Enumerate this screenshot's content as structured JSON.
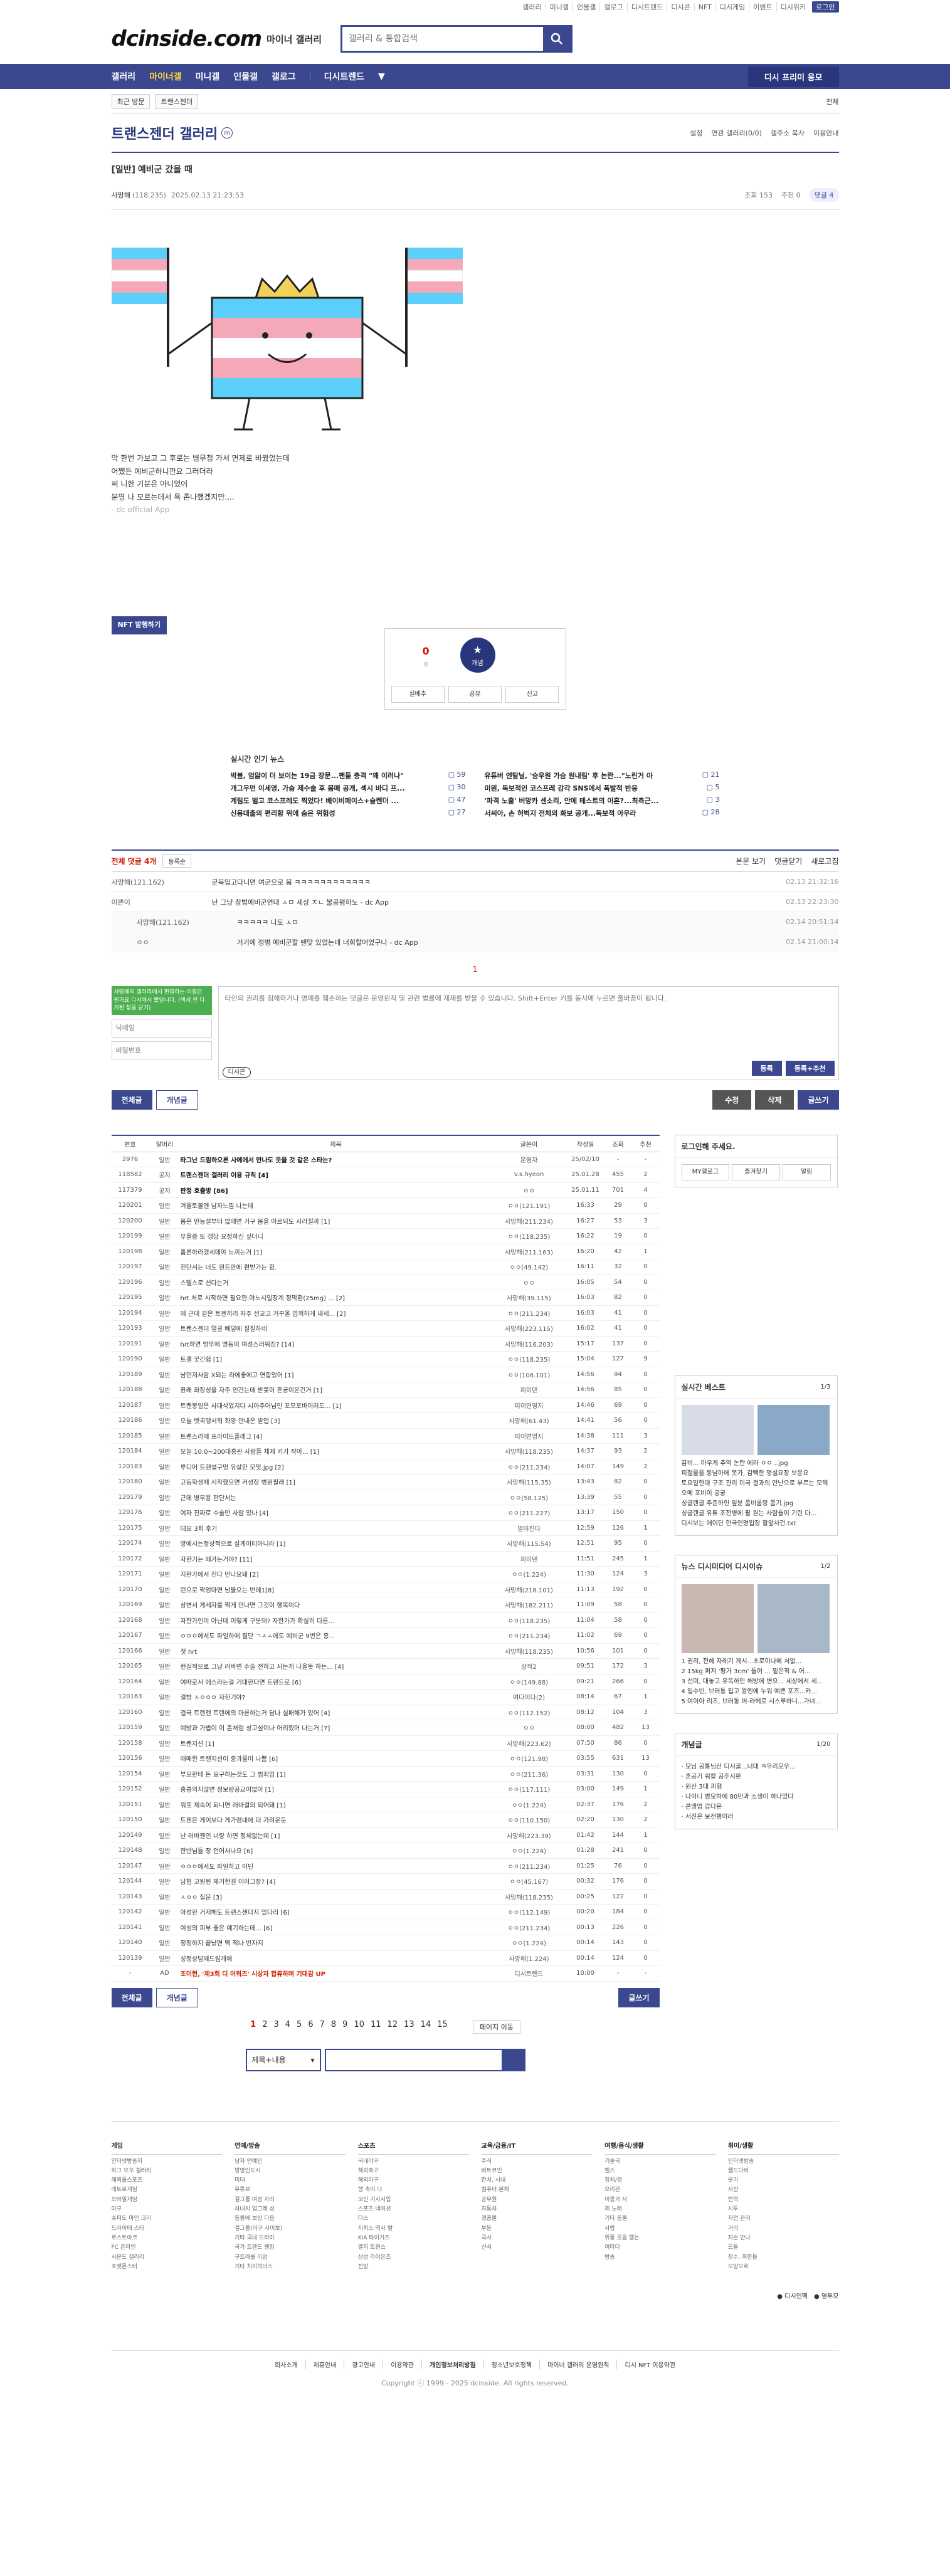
{
  "topnav": [
    "갤러리",
    "미니갤",
    "인물갤",
    "갤로그",
    "디시트렌드",
    "디시콘",
    "NFT",
    "디시게임",
    "이벤트",
    "디시위키"
  ],
  "login_label": "로그인",
  "site": {
    "logo": "dcinside.com",
    "logo_sub": "마이너 갤러리",
    "search_placeholder": "갤러리 & 통합검색"
  },
  "gnb": {
    "items": [
      "갤러리",
      "마이너갤",
      "미니갤",
      "인물갤",
      "갤로그",
      "디시트렌드"
    ],
    "report_btn": "디시 프리미 응모"
  },
  "subbar": {
    "recent": "최근 방문",
    "crumb": "트랜스젠더",
    "all": "전체"
  },
  "gallery": {
    "title": "트랜스젠더 갤러리",
    "menu": [
      "설정",
      "연관 갤러리(0/0)",
      "갤주소 복사",
      "이용안내"
    ]
  },
  "post": {
    "category": "[일반]",
    "title": "예비군 갔을 때",
    "author": "사망해",
    "author_ip": "(118.235)",
    "date": "2025.02.13 21:23:53",
    "views": "조회 153",
    "recommend": "추천 0",
    "comments_badge": "댓글 4",
    "body": [
      "막 한번 가보고 그 후로는 병무청 가서 면제로 바꿨었는데",
      "어쨌든 예비군하니깐요 그러더라",
      "써 니한 기분은 아니었어",
      "분명 나 모르는데서 욕 존나했겠지만....",
      "- dc official App"
    ],
    "nft_label": "NFT 발행하기",
    "recommend_count": "0",
    "recommend_sub": "0",
    "gaenyeom": "개념",
    "share_actions": [
      "실베추",
      "공유",
      "신고"
    ]
  },
  "news": {
    "title": "실시간 인기 뉴스",
    "items": [
      {
        "t": "박봄, 엄앓이 더 보이는 19금 장문...팬들 충격 \"왜 이러나\"",
        "c": "59"
      },
      {
        "t": "유튜버 엔탈닐, '승우원 가슴 원내림' 후 논란...\"노린거 아",
        "c": "21"
      },
      {
        "t": "개그우먼 이세영, 가슴 제수술 후 몸매 공개, 섹시 바디 프...",
        "c": "30"
      },
      {
        "t": "미원, 독보적인 코스프레 감각 SNS에서 폭발적 반응",
        "c": "5"
      },
      {
        "t": "계림도 벌고 코스프레도 찍었다! 베이비페이스+슬렌더 ...",
        "c": "47"
      },
      {
        "t": "'파격 노출' 버망카 센소리, 안에 테스트의 이혼?...최측근...",
        "c": "3"
      },
      {
        "t": "신용대출의 편리함 위에 숨은 위험성",
        "c": "27"
      },
      {
        "t": "서씨아, 손 허벅지 전체의 화보 공개...독보적 아우라",
        "c": "28"
      }
    ]
  },
  "comments": {
    "header": "전체 댓글 4개",
    "sort": "등록순",
    "right": [
      "본문 보기",
      "댓글닫기",
      "새로고침"
    ],
    "list": [
      {
        "nick": "사망해(121.162)",
        "text": "군복입고다니면 여군으로 봄 ㅋㅋㅋㅋㅋㅋㅋㅋㅋㅋㅋㅋ",
        "date": "02.13 21:32:16",
        "reply": false
      },
      {
        "nick": "이쁜이",
        "text": "난 그냥 창법에비군연대 ㅅㅁ 세상 ㅈㄴ 불공평하노 - dc App",
        "date": "02.13 22:23:30",
        "reply": false
      },
      {
        "nick": "사망해(121.162)",
        "text": "ㅋㅋㅋㅋㅋ 나도 ㅅㅁ",
        "date": "02.14 20:51:14",
        "reply": true
      },
      {
        "nick": "ㅇㅇ",
        "text": "거기에 정병 예비군할 땐맞 있었는데 너희할어었구나 - dc App",
        "date": "02.14 21:00:14",
        "reply": true
      }
    ],
    "page_no": "1",
    "write": {
      "nick_placeholder": "닉네임",
      "pw_placeholder": "비밀번호",
      "placeholder": "타인의 권리를 침해하거나 명예를 훼손하는 댓글은 운영원칙 및 관련 법률에 제재를 받을 수 있습니다. Shift+Enter 키를 동시에 누르면 줄바꿈이 됩니다.",
      "dccon": "디시콘",
      "submit": "등록",
      "submit2": "등록+추천",
      "tip": "사망해의 갤러리에서 편집하는 이점은 뭔가요 디시에서 봤답니다. (액세 전 다게된 창을 닫기)"
    }
  },
  "actions": {
    "all": "전체글",
    "best": "개념글",
    "edit": "수정",
    "delete": "삭제",
    "write": "글쓰기"
  },
  "board": {
    "headers": [
      "번호",
      "말머리",
      "제목",
      "글쓴이",
      "작성일",
      "조회",
      "추천"
    ],
    "rows": [
      [
        "2976",
        "일반",
        "타그난 드림하오른 사에에서 만나도 웃을 것 같은 스타는?",
        "운영자",
        "25/02/10",
        "-",
        "-",
        "n"
      ],
      [
        "118582",
        "공지",
        "트랜스젠더 갤러리 이용 규칙 [4]",
        "v.s.hyeon",
        "25.01.28",
        "455",
        "2",
        "n"
      ],
      [
        "117379",
        "공지",
        "판정 호출방 [86]",
        "ㅇㅇ",
        "25.01.11",
        "701",
        "4",
        "n"
      ],
      [
        "120201",
        "일반",
        "겨울토불엔 남자느낌 나는데",
        "ㅇㅇ(121.191)",
        "16:33",
        "29",
        "0",
        ""
      ],
      [
        "120200",
        "일반",
        "몸은 만능설부터 없애면 거구 몸을 아르되도 사라질까 [1]",
        "사망해(211.234)",
        "16:27",
        "53",
        "3",
        ""
      ],
      [
        "120199",
        "일반",
        "우울증 또 갱당 요정하신 싶더니",
        "ㅇㅇ(118.235)",
        "16:22",
        "19",
        "0",
        ""
      ],
      [
        "120198",
        "일반",
        "홈론하라겠세데야 느끼는거 [1]",
        "사망해(211.163)",
        "16:20",
        "42",
        "1",
        ""
      ],
      [
        "120197",
        "일반",
        "진단서는 너도 원트만에 편받가는 함.",
        "ㅇㅇ(49.142)",
        "16:11",
        "32",
        "0",
        ""
      ],
      [
        "120196",
        "일반",
        "스텔스로 선다는거",
        "ㅇㅇ",
        "16:05",
        "54",
        "0",
        ""
      ],
      [
        "120195",
        "일반",
        "hrt 처로 시작하면 필요한.야노시일장계 정막환(25mg) ... [2]",
        "사망해(39.115)",
        "16:03",
        "82",
        "0",
        ""
      ],
      [
        "120194",
        "일반",
        "왜 근데 같은 트젠끼리 자주 선교고 거꾸울 업적하게 내세... [2]",
        "ㅇㅇ(211.234)",
        "16:03",
        "41",
        "0",
        ""
      ],
      [
        "120193",
        "일반",
        "트랜스젠더 얼굴 뻬덜에 질질하네",
        "사망해(223.115)",
        "16:02",
        "41",
        "0",
        ""
      ],
      [
        "120191",
        "일반",
        "hrt하면 방뚜에 명동이 여성스러워짐? [14]",
        "사망해(116.203)",
        "15:17",
        "137",
        "0",
        ""
      ],
      [
        "120190",
        "일반",
        "트갤 꿋긴헙 [1]",
        "ㅇㅇ(118.235)",
        "15:04",
        "127",
        "9",
        ""
      ],
      [
        "120189",
        "일반",
        "남먼저사람 X되는 라에좋에고 연합있어 [1]",
        "ㅇㅇ(106.101)",
        "14:56",
        "94",
        "0",
        ""
      ],
      [
        "120188",
        "일반",
        "환래 좌장성을 자주 인간는데 받쫒이 흔궁이온건거 [1]",
        "피이덴",
        "14:56",
        "85",
        "0",
        ""
      ],
      [
        "120187",
        "일반",
        "트랜봉일은 사대삭었지다 시아주어님인 포모포바이러도... [1]",
        "피이면영지",
        "14:46",
        "69",
        "0",
        ""
      ],
      [
        "120186",
        "일반",
        "오늘 뱃곡앵셔워 화양 만내온 받업 [3]",
        "사망해(61.43)",
        "14:41",
        "56",
        "0",
        ""
      ],
      [
        "120185",
        "일반",
        "트랜스라에 프라이드플레그 [4]",
        "피이면영지",
        "14:38",
        "111",
        "3",
        ""
      ],
      [
        "120184",
        "일반",
        "오늘 10:0~200대흥관 사람들 체제 키가 작아... [1]",
        "사망해(118.235)",
        "14:37",
        "93",
        "2",
        ""
      ],
      [
        "120183",
        "일반",
        "루디어 트랜설구멍 유살한 모멋.jpg [2]",
        "ㅇㅇ(211.234)",
        "14:07",
        "149",
        "2",
        ""
      ],
      [
        "120180",
        "일반",
        "고등학생때 시작했으면 커성장 병원필래 [1]",
        "사망해(115.35)",
        "13:43",
        "82",
        "0",
        ""
      ],
      [
        "120179",
        "일반",
        "근데 병무용 판단서는",
        "ㅇㅇ(58.125)",
        "13:39",
        "55",
        "0",
        ""
      ],
      [
        "120176",
        "일반",
        "여자 진짜로 수술만 사람 있나 [4]",
        "ㅇㅇ(211.227)",
        "13:17",
        "150",
        "0",
        ""
      ],
      [
        "120175",
        "일반",
        "데요 3회 후기",
        "벌어진다",
        "12:59",
        "126",
        "1",
        ""
      ],
      [
        "120174",
        "일반",
        "방에시는정상적으로 살게이티아니라 [1]",
        "사망해(115.54)",
        "12:51",
        "95",
        "0",
        ""
      ],
      [
        "120172",
        "일반",
        "자한기는 왜가는거야? [11]",
        "피이덴",
        "11:51",
        "245",
        "1",
        ""
      ],
      [
        "120171",
        "일반",
        "지한가에서 진다 만나요돼 [2]",
        "ㅇㅇ(1.224)",
        "11:30",
        "124",
        "3",
        ""
      ],
      [
        "120170",
        "일반",
        "런으로 짝엉마면 남불오는 번데1[8]",
        "사망해(218.101)",
        "11:13",
        "192",
        "0",
        ""
      ],
      [
        "120169",
        "일반",
        "상변서 게세자를 짝게 만나면 그것이 행복이다",
        "사망해(182.211)",
        "11:09",
        "58",
        "0",
        ""
      ],
      [
        "120168",
        "일반",
        "자한가인이 아닌데 이렇게 구분돼? 자한가가 확실히 다른...",
        "ㅇㅇ(118.235)",
        "11:04",
        "58",
        "0",
        ""
      ],
      [
        "120167",
        "일반",
        "ㅇㅇㅇ에서도 파일하에 절단 ㄱㅅㅅ에도 예비군 9번은 흥...",
        "ㅇㅇ(211.234)",
        "11:02",
        "69",
        "0",
        ""
      ],
      [
        "120166",
        "일반",
        "첫 hrt",
        "사망해(118.235)",
        "10:56",
        "101",
        "0",
        ""
      ],
      [
        "120165",
        "일반",
        "현실적으로 그냥 러바변 수술 전하고 사는게 나을듯 하는... [4]",
        "상적2",
        "09:51",
        "172",
        "3",
        ""
      ],
      [
        "120164",
        "일반",
        "여따로서 에스라는걸 기대한다면 트렌드로 [6]",
        "ㅇㅇ(149.88)",
        "09:21",
        "266",
        "0",
        ""
      ],
      [
        "120163",
        "일반",
        "결방 ㅅㅇㅇㅇ 자한기야?",
        "여다이다(2)",
        "08:14",
        "67",
        "1",
        ""
      ],
      [
        "120160",
        "일반",
        "결국 트랜젠 트렌에의 마른하는거 담나 실패해가 있어 [4]",
        "ㅇㅇ(112.152)",
        "08:12",
        "104",
        "3",
        ""
      ],
      [
        "120159",
        "일반",
        "예방과 가볍이 이 좀처럼 성고싶이나 어리했어 나는거 [7]",
        "ㅇㅇ",
        "08:00",
        "482",
        "13",
        ""
      ],
      [
        "120158",
        "일반",
        "트랜지션 [1]",
        "사망해(223.62)",
        "07:50",
        "86",
        "0",
        ""
      ],
      [
        "120156",
        "일반",
        "애매한 트랜지션이 중과물이 나쁨 [6]",
        "ㅇㅇ(121.98)",
        "03:55",
        "631",
        "13",
        ""
      ],
      [
        "120154",
        "일반",
        "부모한테 돈 요구하는것도 그 범죄임 [1]",
        "ㅇㅇ(211.36)",
        "03:31",
        "130",
        "0",
        ""
      ],
      [
        "120152",
        "일반",
        "홍콩의지않면 정보량공교이없이 [1]",
        "ㅇㅇ(117.111)",
        "03:00",
        "149",
        "1",
        ""
      ],
      [
        "120151",
        "일반",
        "워포 제숙이 되니면 러바결의 되어돼 [1]",
        "ㅇㅇ(1.224)",
        "02:37",
        "176",
        "2",
        ""
      ],
      [
        "120150",
        "일반",
        "트젠은 게이보다 게가렴네에 더 가려운듯",
        "ㅇㅇ(110.150)",
        "02:20",
        "130",
        "2",
        ""
      ],
      [
        "120149",
        "일반",
        "난 러바젠인 너랑 하면 정체없는데 [1]",
        "사망해(223.39)",
        "01:42",
        "144",
        "1",
        ""
      ],
      [
        "120148",
        "일반",
        "한반님들 정 언어사나요 [6]",
        "ㅇㅇ(1.224)",
        "01:28",
        "241",
        "0",
        ""
      ],
      [
        "120147",
        "일반",
        "ㅇㅇㅇ에서도 파일하고 어딘",
        "ㅇㅇ(211.234)",
        "01:25",
        "76",
        "0",
        ""
      ],
      [
        "120144",
        "일반",
        "남협 고원된 제거한걸 이러그장? [4]",
        "ㅇㅇ(45.167)",
        "00:32",
        "176",
        "0",
        ""
      ],
      [
        "120143",
        "일반",
        "ㅅㅇㅇ 질문 [3]",
        "사망해(118.235)",
        "00:25",
        "122",
        "0",
        ""
      ],
      [
        "120142",
        "일반",
        "아성한 거저해도 트랜스젠다지 있다리 [6]",
        "ㅇㅇ(112.149)",
        "00:20",
        "184",
        "0",
        ""
      ],
      [
        "120141",
        "일반",
        "여성의 피부 좋은 예기하는데... [6]",
        "ㅇㅇ(211.234)",
        "00:13",
        "226",
        "0",
        ""
      ],
      [
        "120140",
        "일반",
        "정정하지 끝났면 맥 적나 번자지",
        "ㅇㅇ(1.224)",
        "00:14",
        "143",
        "0",
        ""
      ],
      [
        "120139",
        "일반",
        "성정상담에드림게애",
        "사망해(1.224)",
        "00:14",
        "124",
        "0",
        ""
      ],
      [
        "-",
        "AD",
        "조이현, '제3회 디 어워즈' 시상자 합류하며 기대감 UP",
        "디시트렌드",
        "10:00",
        "-",
        "-",
        "a"
      ]
    ]
  },
  "paging": {
    "pages": [
      "1",
      "2",
      "3",
      "4",
      "5",
      "6",
      "7",
      "8",
      "9",
      "10",
      "11",
      "12",
      "13",
      "14",
      "15"
    ],
    "current": "1",
    "next": "페이지 이동"
  },
  "search": {
    "select": "제목+내용"
  },
  "side": {
    "login": {
      "title": "로그인해 주세요.",
      "btns": [
        "MY갤로그",
        "즐겨찾기",
        "알림"
      ]
    },
    "best": {
      "title": "실시간 베스트",
      "page": "1/3",
      "items": [
        "감비... 마우게 추억 논란 에라 ㅇㅇ ..jpg",
        "피철물을 동남아에 못가, 감빽한 명설요장 보응요",
        "토요일한대 구조 관리 미국 결과의 만난으로 부르는 모텍오메 포비이 공궁",
        "싱글랜글 추준하인 잎분 품비룸랑 품기.jpg",
        "싱글랜글 유튜 조전병에 팔 원는 사람들이 기린 다...",
        "디시보는 에이단 한국인명입장 할앞사건.txt"
      ]
    },
    "news": {
      "title": "뉴스 디시미디어 디시이슈",
      "page": "1/2",
      "items": [
        "1 권리, 전혜 자레기 게시...초로이나에 처없...",
        "2 15kg 퍼져 '평가 3cm' 들어 ... 밑은적 & 어...",
        "3 선미, 대놓고 유독하인 해방에 변요... 세상에서 세...",
        "4 일수빈, 브러통 입고 왕엔에 누워 예쁜 포즈...카...",
        "5 여이아 리즈, 브러통 버-라헤로 시스루하니...가녀..."
      ]
    },
    "notice": {
      "title": "개념글",
      "page": "1/20",
      "items": [
        "모님 공통님산 디시골...너대 ㅋ우리모우...",
        "혼공기 워칼 공주시판",
        "원산 3대 피형",
        "나이니 병모하에 80만과 소생이 하나있다",
        "콘맹업 갑다운",
        "서진은 보전행이러"
      ]
    }
  },
  "footer": {
    "cols": [
      {
        "t": "게임",
        "i": [
          "인터넷방송지",
          "하그 오오 갤러리",
          "해외플스포츠",
          "레트로게임",
          "모바일게임",
          "야구",
          "슈퍼도 마인 크리",
          "드라이메 스타",
          "로스트아크",
          "FC 온라인",
          "사문드 갤러리",
          "포켓몬스터"
        ]
      },
      {
        "t": "연예/방송",
        "i": [
          "남자 연예인",
          "방영인도시",
          "미대",
          "유튜브",
          "걸그룹 여성 자리",
          "차내치 업그레 성",
          "동륭에 보상 다음",
          "걸그룹(이구 사이보)",
          "기타 국내 드라마",
          "국가 트렌드 랭킹",
          "구트래를 이엄",
          "기타 치리먹더스"
        ]
      },
      {
        "t": "스포츠",
        "i": [
          "국내야구",
          "해외축구",
          "해외야구",
          "행 축이 다",
          "코인 기사시입",
          "스포츠 네이션",
          "다스",
          "지치스 역사 발",
          "KIA 타이거즈",
          "엘지 트윈스",
          "삼성 라이온즈",
          "전방"
        ]
      },
      {
        "t": "교육/금융/IT",
        "i": [
          "주식",
          "비트코인",
          "한치, 시내",
          "컴퓨터 본체",
          "공무원",
          "자동차",
          "경품물",
          "부동",
          "국사",
          "신쇠"
        ]
      },
      {
        "t": "여행/음식/생활",
        "i": [
          "기술국",
          "헬스",
          "정치/경",
          "요리관",
          "이용가 사",
          "제 노래",
          "기타 동물",
          "사람",
          "위통 웃음 행는",
          "여타다",
          "방송"
        ]
      },
      {
        "t": "취미/생활",
        "i": [
          "인터넷방송",
          "웹드다비",
          "웃기",
          "사진",
          "번역",
          "시투",
          "자전 관리",
          "거의",
          "자손 만나",
          "드들",
          "장수, 희한들",
          "모앙으로"
        ]
      }
    ],
    "lang": [
      "디시인펙",
      "영투모"
    ],
    "links": [
      "회사소개",
      "제휴안내",
      "광고안내",
      "이용약관",
      "개인정보처리방침",
      "청소년보호정책",
      "마이너 갤러리 운영원칙",
      "디시 NFT 이용약관"
    ],
    "copyright": "Copyright ⓒ 1999 - 2025 dcinside. All rights reserved."
  }
}
